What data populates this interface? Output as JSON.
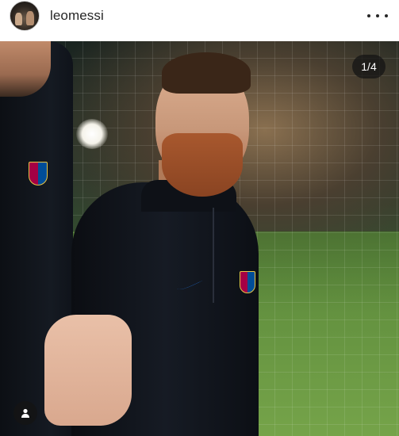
{
  "header": {
    "username": "leomessi",
    "avatar_icon": "profile-avatar",
    "more_icon": "more-horizontal-icon"
  },
  "post": {
    "carousel_counter": "1/4",
    "tag_icon": "user-tag-icon",
    "colors": {
      "counter_bg": "#141414",
      "nike_swoosh": "#1f6ed4",
      "barca_crest_red": "#a50044",
      "barca_crest_blue": "#004d98"
    }
  }
}
